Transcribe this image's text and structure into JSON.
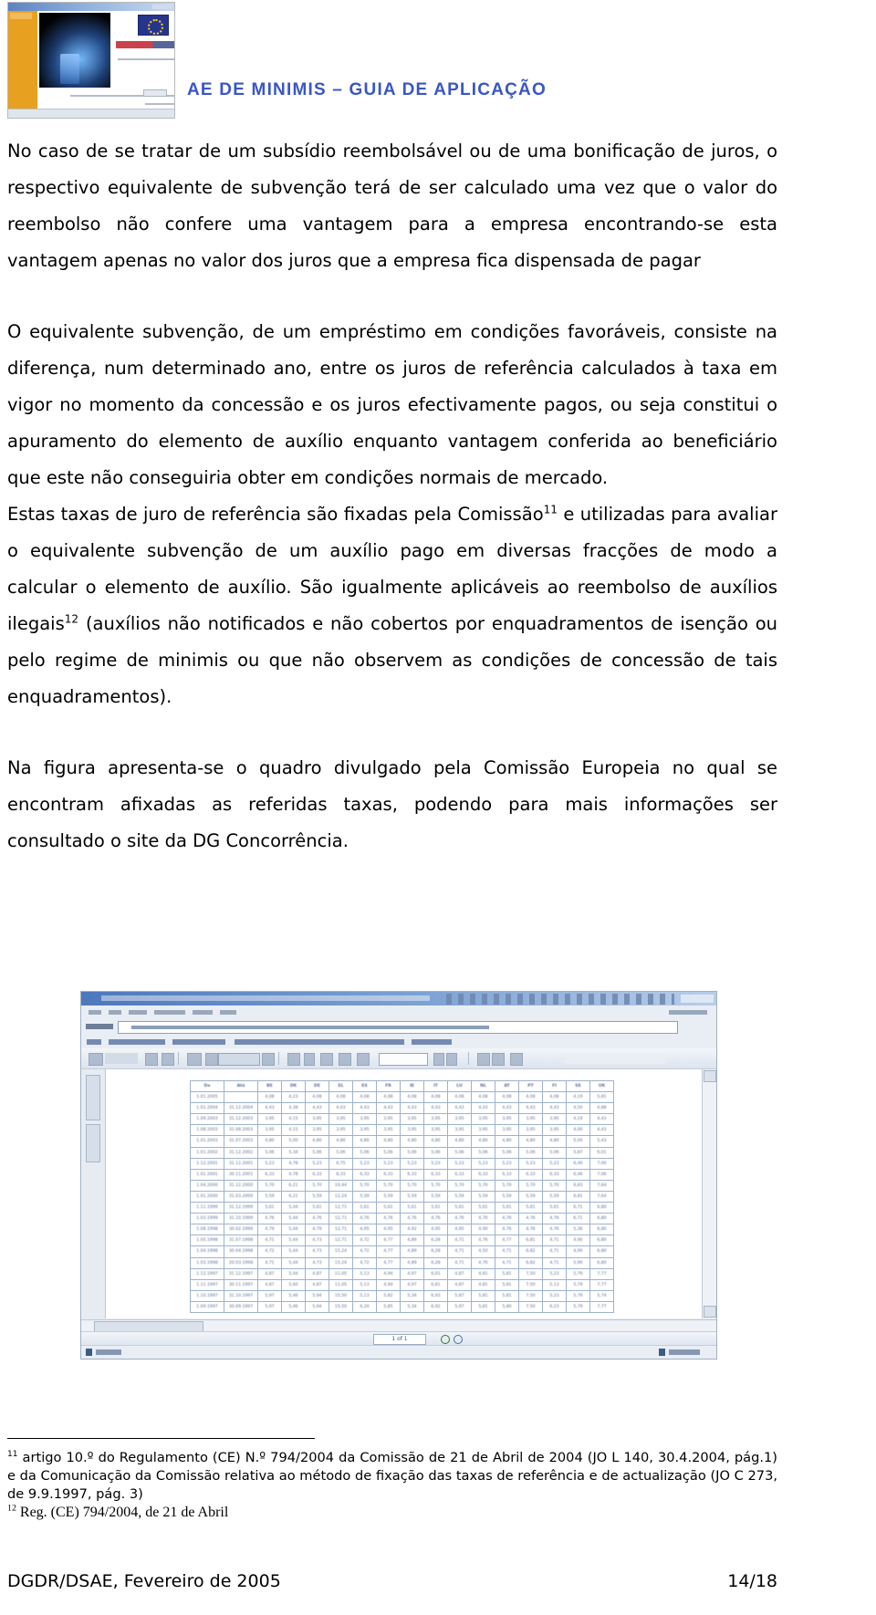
{
  "header": {
    "title": "AE DE MINIMIS – GUIA DE APLICAÇÃO",
    "title_color": "#3a56c4",
    "logo": {
      "name": "minimis-guide-slide-thumbnail",
      "sidebar_color": "#e8a020",
      "red_heading": "Minimis DGDR",
      "eu_flag": "eu-flag-icon"
    }
  },
  "body": {
    "paragraph_1": "No caso de se tratar de um subsídio reembolsável ou de uma bonificação de juros, o respectivo equivalente de subvenção terá de ser calculado uma vez que o valor do reembolso não confere uma vantagem para a empresa encontrando-se esta vantagem apenas no valor dos juros que a empresa fica dispensada de pagar",
    "paragraph_2_a": "O equivalente subvenção, de um empréstimo em condições favoráveis, consiste na diferença, num determinado ano, entre os juros de referência calculados à taxa em vigor no momento da concessão e os juros efectivamente pagos, ou seja constitui o apuramento do elemento de auxílio enquanto vantagem conferida ao beneficiário que este não conseguiria obter em condições normais de mercado.",
    "paragraph_2_b_pre": "Estas taxas de juro de referência são fixadas pela Comissão",
    "paragraph_2_b_sup1": "11",
    "paragraph_2_b_mid": " e utilizadas para avaliar o equivalente subvenção de um auxílio pago em diversas fracções de modo a calcular o elemento de auxílio. São igualmente aplicáveis ao reembolso de auxílios ilegais",
    "paragraph_2_b_sup2": "12",
    "paragraph_2_b_post": " (auxílios não notificados e não cobertos por enquadramentos de isenção ou pelo regime de minimis ou que não observem as condições de concessão de tais enquadramentos).",
    "paragraph_3": "Na figura apresenta-se o quadro divulgado pela Comissão Europeia no qual se encontram afixadas as referidas taxas, podendo para mais informações ser consultado o site da DG Concorrência."
  },
  "figure": {
    "name": "reference-rates-browser-screenshot",
    "page_indicator": "1 of 1",
    "table": {
      "headers": [
        "De",
        "Até",
        "BE",
        "DK",
        "DE",
        "EL",
        "ES",
        "FR",
        "IE",
        "IT",
        "LU",
        "NL",
        "AT",
        "PT",
        "FI",
        "SE",
        "UK"
      ],
      "rows": [
        [
          "1.01.2005",
          "",
          "4,08",
          "4,23",
          "4,08",
          "4,08",
          "4,08",
          "4,08",
          "4,08",
          "4,08",
          "4,08",
          "4,08",
          "4,08",
          "4,08",
          "4,08",
          "4,19",
          "5,81"
        ],
        [
          "1.01.2004",
          "31.12.2004",
          "4,43",
          "4,38",
          "4,43",
          "4,43",
          "4,43",
          "4,43",
          "4,43",
          "4,43",
          "4,43",
          "4,43",
          "4,43",
          "4,43",
          "4,43",
          "4,50",
          "4,88"
        ],
        [
          "1.09.2003",
          "31.12.2003",
          "3,95",
          "4,15",
          "3,95",
          "3,95",
          "3,95",
          "3,95",
          "3,95",
          "3,95",
          "3,95",
          "3,95",
          "3,95",
          "3,95",
          "3,95",
          "4,19",
          "4,43"
        ],
        [
          "1.08.2003",
          "31.08.2003",
          "3,95",
          "4,15",
          "3,95",
          "3,95",
          "3,95",
          "3,95",
          "3,95",
          "3,95",
          "3,95",
          "3,95",
          "3,95",
          "3,95",
          "3,95",
          "4,00",
          "4,43"
        ],
        [
          "1.01.2003",
          "31.07.2003",
          "4,80",
          "5,00",
          "4,80",
          "4,80",
          "4,80",
          "4,80",
          "4,80",
          "4,80",
          "4,80",
          "4,80",
          "4,80",
          "4,80",
          "4,80",
          "5,00",
          "5,43"
        ],
        [
          "1.01.2002",
          "31.12.2002",
          "5,06",
          "5,34",
          "5,06",
          "5,06",
          "5,06",
          "5,06",
          "5,06",
          "5,06",
          "5,06",
          "5,06",
          "5,06",
          "5,06",
          "5,06",
          "5,87",
          "6,01"
        ],
        [
          "1.12.2001",
          "31.12.2001",
          "5,23",
          "4,78",
          "5,23",
          "6,75",
          "5,23",
          "5,23",
          "5,23",
          "5,23",
          "5,23",
          "5,23",
          "5,23",
          "5,23",
          "5,23",
          "6,40",
          "7,00"
        ],
        [
          "1.01.2001",
          "30.11.2001",
          "6,33",
          "4,78",
          "6,33",
          "8,33",
          "6,33",
          "6,33",
          "6,33",
          "6,33",
          "6,33",
          "6,33",
          "6,33",
          "6,33",
          "6,33",
          "6,46",
          "7,06"
        ],
        [
          "1.04.2000",
          "31.12.2000",
          "5,70",
          "6,21",
          "5,70",
          "10,44",
          "5,70",
          "5,70",
          "5,70",
          "5,70",
          "5,70",
          "5,70",
          "5,70",
          "5,70",
          "5,70",
          "6,83",
          "7,64"
        ],
        [
          "1.01.2000",
          "31.03.2000",
          "5,59",
          "6,21",
          "5,59",
          "12,24",
          "5,59",
          "5,59",
          "5,59",
          "5,59",
          "5,59",
          "5,59",
          "5,59",
          "5,59",
          "5,59",
          "6,81",
          "7,64"
        ],
        [
          "1.11.1999",
          "31.12.1999",
          "5,61",
          "5,44",
          "5,61",
          "12,71",
          "5,61",
          "5,61",
          "5,61",
          "5,61",
          "5,61",
          "5,61",
          "5,61",
          "5,61",
          "5,61",
          "6,71",
          "6,80"
        ],
        [
          "1.03.1999",
          "31.10.1999",
          "4,76",
          "5,44",
          "4,76",
          "12,71",
          "4,76",
          "4,76",
          "4,76",
          "4,76",
          "4,76",
          "4,76",
          "4,76",
          "4,76",
          "4,76",
          "6,71",
          "6,80"
        ],
        [
          "1.08.1998",
          "30.02.1999",
          "4,79",
          "5,44",
          "4,79",
          "12,71",
          "4,95",
          "4,95",
          "4,92",
          "4,95",
          "4,95",
          "4,90",
          "4,76",
          "4,76",
          "4,76",
          "5,36",
          "6,80"
        ],
        [
          "1.05.1998",
          "31.07.1998",
          "4,71",
          "5,44",
          "4,73",
          "12,71",
          "4,72",
          "4,77",
          "4,89",
          "6,28",
          "4,71",
          "4,76",
          "4,77",
          "6,81",
          "4,71",
          "4,90",
          "6,80"
        ],
        [
          "1.04.1998",
          "30.04.1998",
          "4,72",
          "5,44",
          "4,73",
          "15,24",
          "4,72",
          "4,77",
          "4,89",
          "6,28",
          "4,71",
          "4,50",
          "4,71",
          "6,82",
          "4,71",
          "4,90",
          "6,80"
        ],
        [
          "1.03.1998",
          "20.03.1998",
          "4,71",
          "5,44",
          "4,73",
          "15,24",
          "4,72",
          "4,77",
          "4,89",
          "6,28",
          "4,71",
          "4,76",
          "4,71",
          "6,82",
          "4,71",
          "5,90",
          "6,80"
        ],
        [
          "1.12.1997",
          "31.12.1997",
          "4,87",
          "5,44",
          "4,87",
          "11,05",
          "5,13",
          "4,94",
          "4,97",
          "6,01",
          "4,87",
          "4,81",
          "5,81",
          "7,50",
          "5,23",
          "5,79",
          "7,77"
        ],
        [
          "1.11.1997",
          "30.11.1997",
          "4,87",
          "5,60",
          "4,87",
          "11,05",
          "5,13",
          "4,94",
          "4,97",
          "6,81",
          "4,87",
          "4,81",
          "5,81",
          "7,50",
          "5,13",
          "5,79",
          "7,77"
        ],
        [
          "1.10.1997",
          "31.10.1997",
          "5,97",
          "5,46",
          "5,94",
          "15,50",
          "5,13",
          "5,82",
          "5,34",
          "6,93",
          "5,87",
          "5,81",
          "5,81",
          "7,50",
          "5,23",
          "5,79",
          "5,74"
        ],
        [
          "1.09.1997",
          "30.09.1997",
          "5,97",
          "5,46",
          "5,94",
          "15,50",
          "6,20",
          "5,85",
          "5,34",
          "6,92",
          "5,97",
          "5,81",
          "5,80",
          "7,50",
          "6,23",
          "5,79",
          "7,77"
        ]
      ]
    }
  },
  "footnotes": {
    "note_11_marker": "11",
    "note_11": " artigo 10.º do Regulamento (CE) N.º 794/2004 da Comissão de 21 de Abril de 2004 (JO L 140, 30.4.2004, pág.1) e da Comunicação da Comissão relativa ao método de fixação das taxas de referência e de actualização (JO C 273, de 9.9.1997, pág. 3)",
    "note_12_marker": "12",
    "note_12": " Reg. (CE) 794/2004, de 21 de Abril"
  },
  "footer": {
    "left": "DGDR/DSAE, Fevereiro de 2005",
    "right": "14/18"
  }
}
